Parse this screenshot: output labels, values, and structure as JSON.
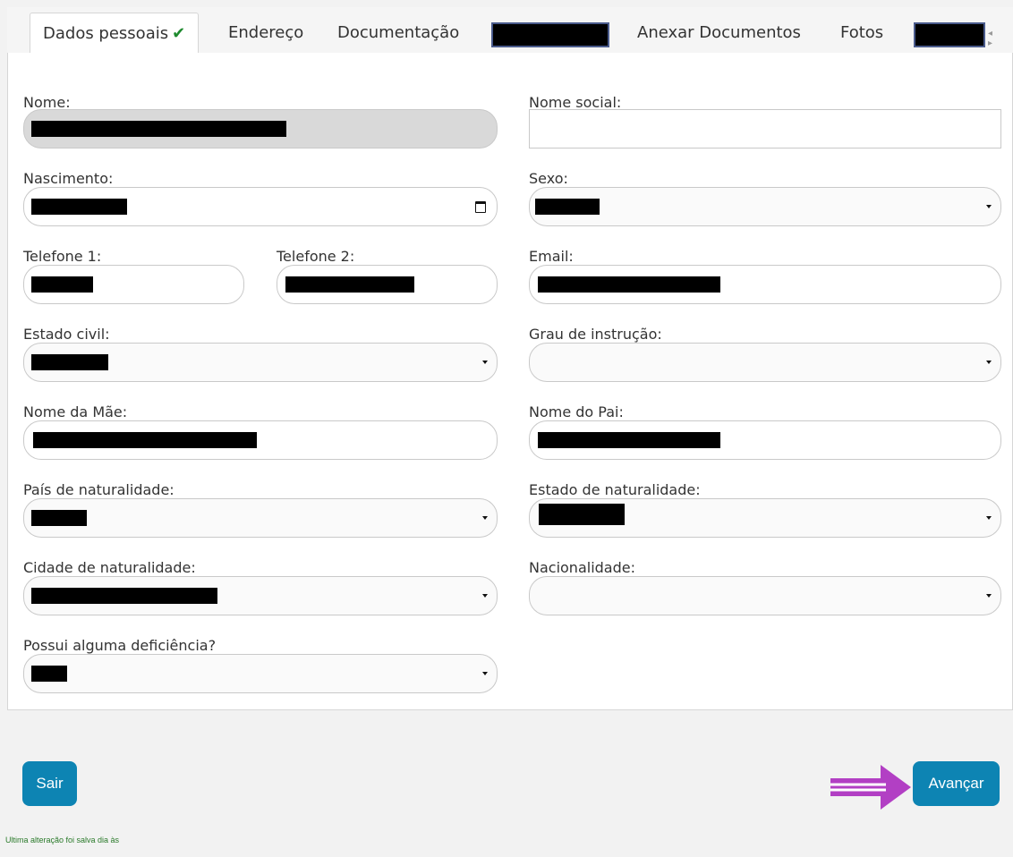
{
  "tabs": {
    "dados_pessoais": "Dados pessoais",
    "dados_check": "✔",
    "endereco": "Endereço",
    "documentacao": "Documentação",
    "anexar": "Anexar Documentos",
    "fotos": "Fotos",
    "arrows": "◂ ▸"
  },
  "form": {
    "nome_label": "Nome:",
    "nome_social_label": "Nome social:",
    "nascimento_label": "Nascimento:",
    "sexo_label": "Sexo:",
    "telefone1_label": "Telefone 1:",
    "telefone2_label": "Telefone 2:",
    "email_label": "Email:",
    "estado_civil_label": "Estado civil:",
    "grau_label": "Grau de instrução:",
    "mae_label": "Nome da Mãe:",
    "pai_label": "Nome do Pai:",
    "pais_label": "País de naturalidade:",
    "estado_nat_label": "Estado de naturalidade:",
    "cidade_label": "Cidade de naturalidade:",
    "nacionalidade_label": "Nacionalidade:",
    "deficiencia_label": "Possui alguma deficiência?"
  },
  "footer": {
    "sair_label": "Sair",
    "avancar_label": "Avançar",
    "status_text": "Ultima alteração foi salva dia às"
  },
  "colors": {
    "accent": "#0d84b3",
    "arrow": "#b23fc4",
    "check": "#1e8a2e"
  },
  "icons": {
    "check": "check-icon",
    "calendar": "calendar-icon",
    "caret": "chevron-down-icon",
    "arrow": "arrow-right-icon"
  }
}
